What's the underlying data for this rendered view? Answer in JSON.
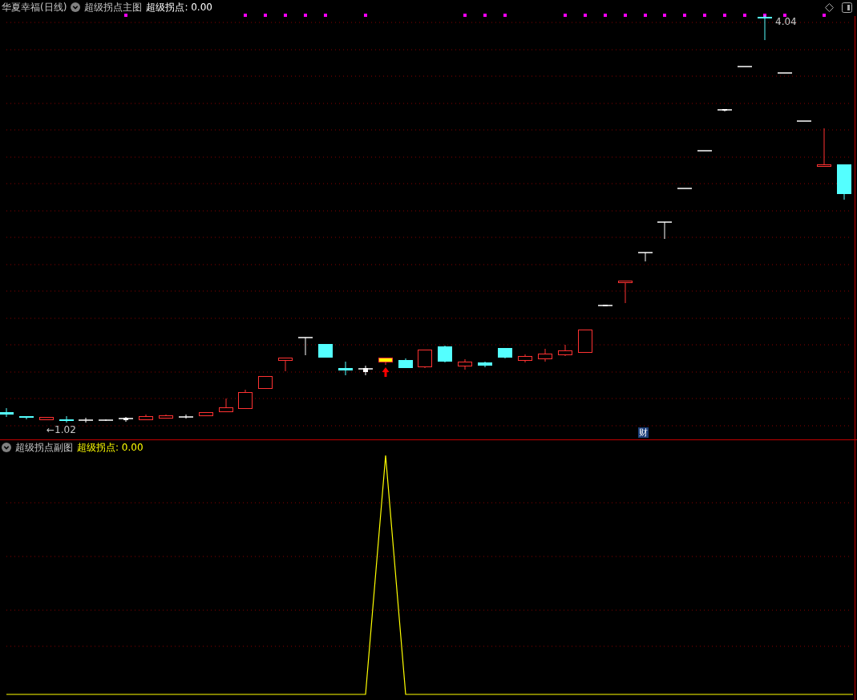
{
  "main_chart": {
    "stock": "华夏幸福(日线)",
    "indicator_name": "超级拐点主图",
    "indicator_value": "超级拐点: 0.00",
    "high_label": "4.04",
    "low_label": "←1.02",
    "event_badge": "财"
  },
  "sub_chart": {
    "indicator_name": "超级拐点副图",
    "indicator_value": "超级拐点: 0.00"
  }
}
